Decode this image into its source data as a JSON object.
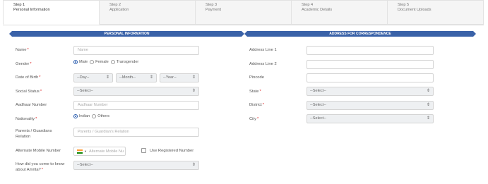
{
  "steps": [
    {
      "num": "Step 1",
      "name": "Personal Information"
    },
    {
      "num": "Step 2",
      "name": "Application"
    },
    {
      "num": "Step 3",
      "name": "Payment"
    },
    {
      "num": "Step 4",
      "name": "Academic Details"
    },
    {
      "num": "Step 5",
      "name": "Document Uploads"
    }
  ],
  "sections": {
    "personal": "PERSONAL INFORMATION",
    "address": "ADDRESS FOR CORRESPONDENCE"
  },
  "personal": {
    "name": {
      "label": "Name",
      "placeholder": "Name"
    },
    "gender": {
      "label": "Gender",
      "options": [
        "Male",
        "Female",
        "Transgender"
      ],
      "selected": "Male"
    },
    "dob": {
      "label": "Date of Birth",
      "day": "--Day--",
      "month": "--Month--",
      "year": "--Year--"
    },
    "social_status": {
      "label": "Social Status",
      "value": "--Select--"
    },
    "aadhaar": {
      "label": "Aadhaar Number",
      "placeholder": "Aadhaar Number"
    },
    "nationality": {
      "label": "Nationality",
      "options": [
        "Indian",
        "Others"
      ],
      "selected": "Indian"
    },
    "guardian": {
      "label": "Parents / Guardians Relation",
      "placeholder": "Parents / Guardian's Relation"
    },
    "alt_mobile": {
      "label": "Alternate Mobile Number",
      "placeholder": "Alternate Mobile Nu",
      "checkbox_label": "Use Registered Number"
    },
    "source": {
      "label": "How did you come to know about Amrita?",
      "value": "--Select--"
    }
  },
  "address": {
    "line1": {
      "label": "Address Line 1"
    },
    "line2": {
      "label": "Address Line 2"
    },
    "pincode": {
      "label": "Pincode"
    },
    "state": {
      "label": "State",
      "value": "--Select--"
    },
    "district": {
      "label": "District",
      "value": "--Select--"
    },
    "city": {
      "label": "City",
      "value": "--Select--"
    }
  },
  "required_mark": "*",
  "icons": {
    "select_caret": "updown-caret-icon",
    "flag": "india-flag-icon"
  },
  "colors": {
    "banner": "#3a62a8",
    "required": "#dd2222",
    "field_bg": "#eef0f2"
  }
}
